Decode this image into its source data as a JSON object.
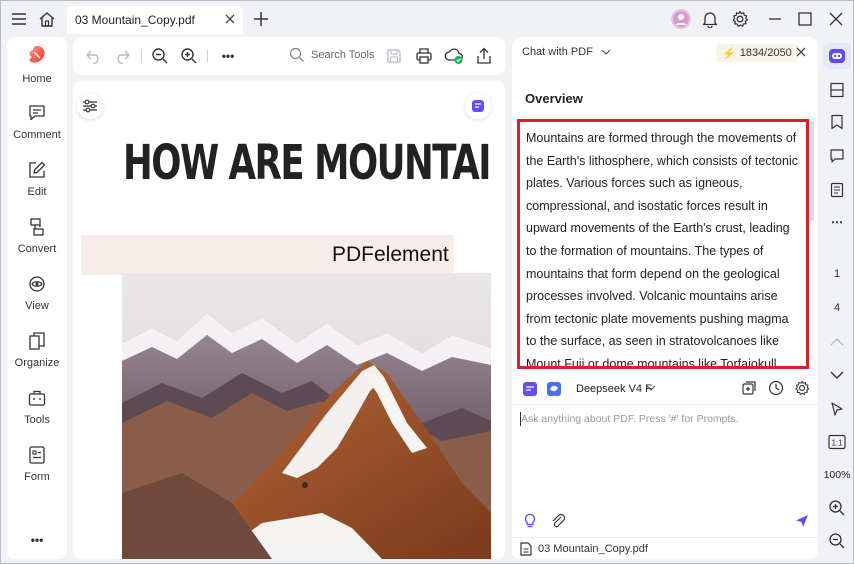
{
  "titlebar": {
    "tab_label": "03 Mountain_Copy.pdf"
  },
  "sidebar": {
    "items": [
      {
        "label": "Home",
        "icon": "home-logo-icon"
      },
      {
        "label": "Comment",
        "icon": "comment-icon"
      },
      {
        "label": "Edit",
        "icon": "edit-icon"
      },
      {
        "label": "Convert",
        "icon": "convert-icon"
      },
      {
        "label": "View",
        "icon": "view-icon"
      },
      {
        "label": "Organize",
        "icon": "organize-icon"
      },
      {
        "label": "Tools",
        "icon": "tools-icon"
      },
      {
        "label": "Form",
        "icon": "form-icon"
      }
    ],
    "more": "•••"
  },
  "toolbar": {
    "search_label": "Search Tools",
    "more": "•••"
  },
  "document": {
    "title": "HOW ARE MOUNTAINS",
    "brand": "PDFelement"
  },
  "chat": {
    "mode": "Chat with PDF",
    "credits": "1834/2050",
    "overview_heading": "Overview",
    "answer": "Mountains are formed through the movements of the Earth's lithosphere, which consists of tectonic plates. Various forces such as igneous, compressional, and isostatic forces result in upward movements of the Earth's crust, leading to the formation of mountains. The types of mountains that form depend on the geological processes involved. Volcanic mountains arise from tectonic plate movements pushing magma to the surface, as seen in stratovolcanoes like Mount Fuji or dome mountains like Torfajokull. Fold mountains occur",
    "model": "Deepseek V4 F",
    "input_placeholder": "Ask anything about PDF. Press '#' for Prompts.",
    "file_name": "03 Mountain_Copy.pdf"
  },
  "rail": {
    "page_current": "1",
    "page_total": "4",
    "zoom": "100%"
  },
  "colors": {
    "accent": "#5b4cf5",
    "highlight_border": "#d5222b",
    "credits_bolt": "#e9a21b"
  }
}
